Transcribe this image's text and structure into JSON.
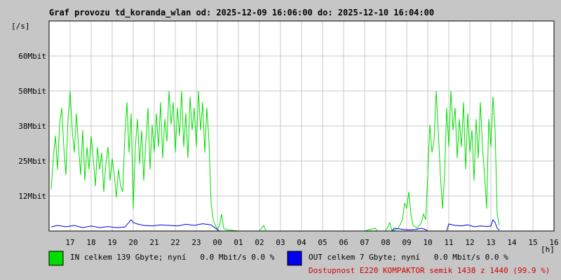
{
  "chart_data": {
    "type": "line",
    "title": "Graf provozu td_koranda_wlan od: 2025-12-09 16:06:00 do: 2025-12-10 16:04:00",
    "ylabel": "[/s]",
    "xlabel": "[h]",
    "y_ticks": [
      "12Mbit",
      "25Mbit",
      "38Mbit",
      "50Mbit",
      "60Mbit"
    ],
    "x_ticks": [
      "17",
      "18",
      "19",
      "20",
      "21",
      "22",
      "23",
      "00",
      "01",
      "02",
      "03",
      "04",
      "05",
      "06",
      "07",
      "08",
      "09",
      "10",
      "11",
      "12",
      "13",
      "14",
      "15",
      "16"
    ],
    "ylim": [
      0,
      75
    ],
    "grid": true,
    "series": [
      {
        "name": "IN celkem 139 Gbyte; nyní   0.0 Mbit/s 0.0 %",
        "color": "#00dd00",
        "points": [
          [
            16.1,
            15
          ],
          [
            16.2,
            26
          ],
          [
            16.3,
            34
          ],
          [
            16.4,
            22
          ],
          [
            16.5,
            38
          ],
          [
            16.6,
            44
          ],
          [
            16.7,
            30
          ],
          [
            16.8,
            20
          ],
          [
            16.9,
            40
          ],
          [
            17.0,
            50
          ],
          [
            17.1,
            36
          ],
          [
            17.2,
            28
          ],
          [
            17.3,
            42
          ],
          [
            17.4,
            30
          ],
          [
            17.5,
            20
          ],
          [
            17.6,
            36
          ],
          [
            17.7,
            18
          ],
          [
            17.8,
            30
          ],
          [
            17.9,
            22
          ],
          [
            18.0,
            34
          ],
          [
            18.1,
            26
          ],
          [
            18.2,
            16
          ],
          [
            18.3,
            30
          ],
          [
            18.4,
            22
          ],
          [
            18.5,
            28
          ],
          [
            18.6,
            14
          ],
          [
            18.7,
            24
          ],
          [
            18.8,
            30
          ],
          [
            18.9,
            18
          ],
          [
            19.0,
            26
          ],
          [
            19.1,
            20
          ],
          [
            19.2,
            12
          ],
          [
            19.3,
            22
          ],
          [
            19.4,
            16
          ],
          [
            19.5,
            14
          ],
          [
            19.6,
            34
          ],
          [
            19.7,
            46
          ],
          [
            19.8,
            28
          ],
          [
            19.9,
            42
          ],
          [
            20.0,
            8
          ],
          [
            20.1,
            30
          ],
          [
            20.2,
            40
          ],
          [
            20.3,
            24
          ],
          [
            20.4,
            36
          ],
          [
            20.5,
            18
          ],
          [
            20.6,
            32
          ],
          [
            20.7,
            44
          ],
          [
            20.8,
            22
          ],
          [
            20.9,
            38
          ],
          [
            21.0,
            28
          ],
          [
            21.1,
            42
          ],
          [
            21.2,
            30
          ],
          [
            21.3,
            46
          ],
          [
            21.4,
            26
          ],
          [
            21.5,
            40
          ],
          [
            21.6,
            32
          ],
          [
            21.7,
            50
          ],
          [
            21.8,
            38
          ],
          [
            21.9,
            46
          ],
          [
            22.0,
            28
          ],
          [
            22.1,
            44
          ],
          [
            22.2,
            34
          ],
          [
            22.3,
            50
          ],
          [
            22.4,
            30
          ],
          [
            22.5,
            42
          ],
          [
            22.6,
            26
          ],
          [
            22.7,
            48
          ],
          [
            22.8,
            36
          ],
          [
            22.9,
            44
          ],
          [
            23.0,
            30
          ],
          [
            23.1,
            50
          ],
          [
            23.2,
            36
          ],
          [
            23.3,
            46
          ],
          [
            23.4,
            28
          ],
          [
            23.5,
            44
          ],
          [
            23.6,
            32
          ],
          [
            23.7,
            10
          ],
          [
            23.8,
            4
          ],
          [
            23.9,
            2
          ],
          [
            24.0,
            0.5
          ],
          [
            24.1,
            2
          ],
          [
            24.2,
            6
          ],
          [
            24.3,
            1
          ],
          [
            24.4,
            0.5
          ],
          [
            24.6,
            0.3
          ],
          [
            25.0,
            0
          ],
          [
            26.0,
            0
          ],
          [
            26.2,
            2
          ],
          [
            26.3,
            0
          ],
          [
            27.0,
            0
          ],
          [
            28.0,
            0
          ],
          [
            29.0,
            0
          ],
          [
            30.0,
            0
          ],
          [
            31.0,
            0
          ],
          [
            31.5,
            1
          ],
          [
            31.6,
            0
          ],
          [
            32.0,
            0
          ],
          [
            32.2,
            3
          ],
          [
            32.3,
            0
          ],
          [
            32.6,
            1
          ],
          [
            32.8,
            4
          ],
          [
            32.9,
            10
          ],
          [
            33.0,
            8
          ],
          [
            33.1,
            14
          ],
          [
            33.2,
            6
          ],
          [
            33.3,
            2
          ],
          [
            33.5,
            1
          ],
          [
            33.7,
            3
          ],
          [
            33.8,
            6
          ],
          [
            33.9,
            4
          ],
          [
            34.0,
            20
          ],
          [
            34.1,
            38
          ],
          [
            34.2,
            28
          ],
          [
            34.3,
            32
          ],
          [
            34.4,
            50
          ],
          [
            34.5,
            36
          ],
          [
            34.6,
            20
          ],
          [
            34.7,
            8
          ],
          [
            34.8,
            20
          ],
          [
            34.9,
            44
          ],
          [
            35.0,
            30
          ],
          [
            35.1,
            50
          ],
          [
            35.2,
            36
          ],
          [
            35.3,
            44
          ],
          [
            35.4,
            26
          ],
          [
            35.5,
            40
          ],
          [
            35.6,
            30
          ],
          [
            35.7,
            46
          ],
          [
            35.8,
            22
          ],
          [
            35.9,
            42
          ],
          [
            36.0,
            28
          ],
          [
            36.1,
            36
          ],
          [
            36.2,
            18
          ],
          [
            36.3,
            40
          ],
          [
            36.4,
            26
          ],
          [
            36.5,
            46
          ],
          [
            36.6,
            30
          ],
          [
            36.7,
            20
          ],
          [
            36.8,
            8
          ],
          [
            36.9,
            40
          ],
          [
            37.0,
            30
          ],
          [
            37.1,
            48
          ],
          [
            37.2,
            36
          ],
          [
            37.3,
            6
          ],
          [
            37.4,
            2
          ]
        ]
      },
      {
        "name": "OUT celkem 7 Gbyte; nyní   0.0 Mbit/s 0.0 %",
        "color": "#0000ee",
        "points": [
          [
            16.1,
            1.5
          ],
          [
            16.4,
            2
          ],
          [
            16.8,
            1.5
          ],
          [
            17.2,
            2
          ],
          [
            17.6,
            1.2
          ],
          [
            18.0,
            1.8
          ],
          [
            18.4,
            1.2
          ],
          [
            18.8,
            1.6
          ],
          [
            19.2,
            1.2
          ],
          [
            19.6,
            1.4
          ],
          [
            19.9,
            4
          ],
          [
            20.0,
            3
          ],
          [
            20.2,
            2.5
          ],
          [
            20.5,
            2
          ],
          [
            20.9,
            1.8
          ],
          [
            21.3,
            2.2
          ],
          [
            21.7,
            2
          ],
          [
            22.1,
            1.8
          ],
          [
            22.5,
            2.4
          ],
          [
            22.9,
            2
          ],
          [
            23.3,
            2.6
          ],
          [
            23.7,
            2.2
          ],
          [
            23.9,
            1
          ],
          [
            24.1,
            0
          ],
          [
            26.0,
            0
          ],
          [
            32.3,
            0
          ],
          [
            32.4,
            1
          ],
          [
            32.6,
            0.8
          ],
          [
            32.9,
            0.5
          ],
          [
            33.1,
            0.4
          ],
          [
            33.4,
            0.5
          ],
          [
            33.7,
            1
          ],
          [
            33.9,
            0.5
          ],
          [
            34.0,
            0
          ],
          [
            34.9,
            0
          ],
          [
            35.0,
            2.5
          ],
          [
            35.3,
            2
          ],
          [
            35.6,
            1.8
          ],
          [
            35.9,
            2.2
          ],
          [
            36.2,
            1.5
          ],
          [
            36.5,
            1.8
          ],
          [
            36.8,
            1.6
          ],
          [
            37.0,
            1.8
          ],
          [
            37.1,
            4
          ],
          [
            37.2,
            3
          ],
          [
            37.3,
            1
          ],
          [
            37.4,
            0.3
          ]
        ]
      }
    ]
  },
  "legend": {
    "in_color": "#00dd00",
    "out_color": "#0000ee",
    "in_label": "IN celkem 139 Gbyte; nyní   0.0 Mbit/s 0.0 %",
    "out_label": "OUT celkem 7 Gbyte; nyní   0.0 Mbit/s 0.0 %",
    "availability": "Dostupnost E220 KOMPAKTOR semik 1438 z 1440 (99.9 %)"
  }
}
